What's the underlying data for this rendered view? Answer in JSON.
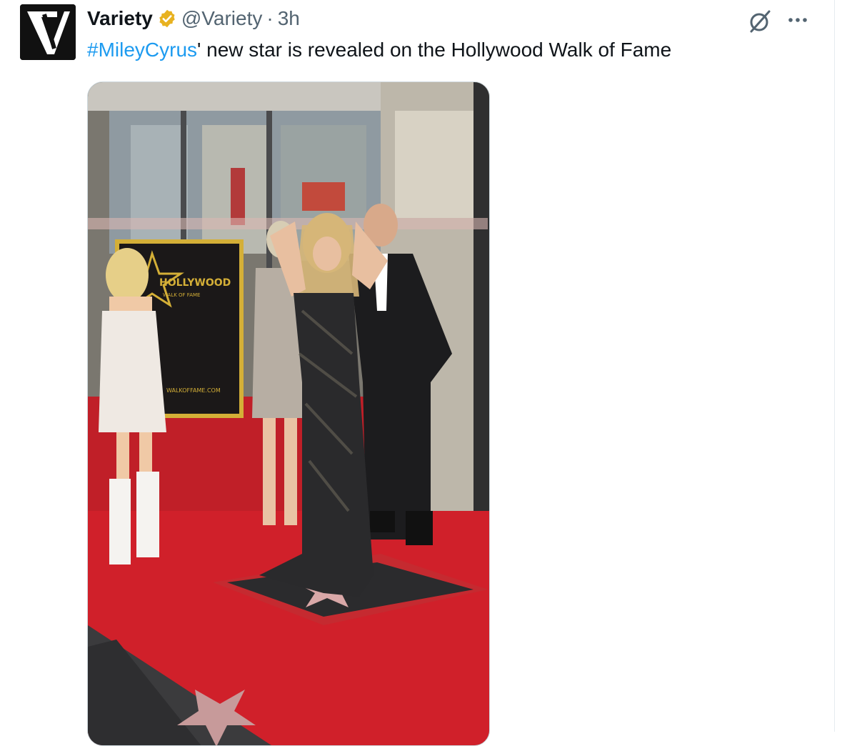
{
  "tweet": {
    "author": {
      "display_name": "Variety",
      "handle": "@Variety",
      "separator": "·",
      "time": "3h",
      "verified": true,
      "verified_color": "#e8b220",
      "avatar_icon": "variety-v-logo"
    },
    "text": {
      "hashtag": "#MileyCyrus",
      "rest": "' new star is revealed on the Hollywood Walk of Fame"
    },
    "actions": {
      "grok_icon": "grok-icon",
      "more_icon": "more-icon"
    },
    "media": {
      "sign_title": "HOLLYWOOD",
      "sign_subtitle": "WALK OF FAME",
      "sign_url": "WALKOFFAME.COM",
      "accent_color": "#d0202a"
    }
  },
  "colors": {
    "link": "#1d9bf0",
    "secondary_text": "#536471",
    "primary_text": "#0f1419"
  }
}
